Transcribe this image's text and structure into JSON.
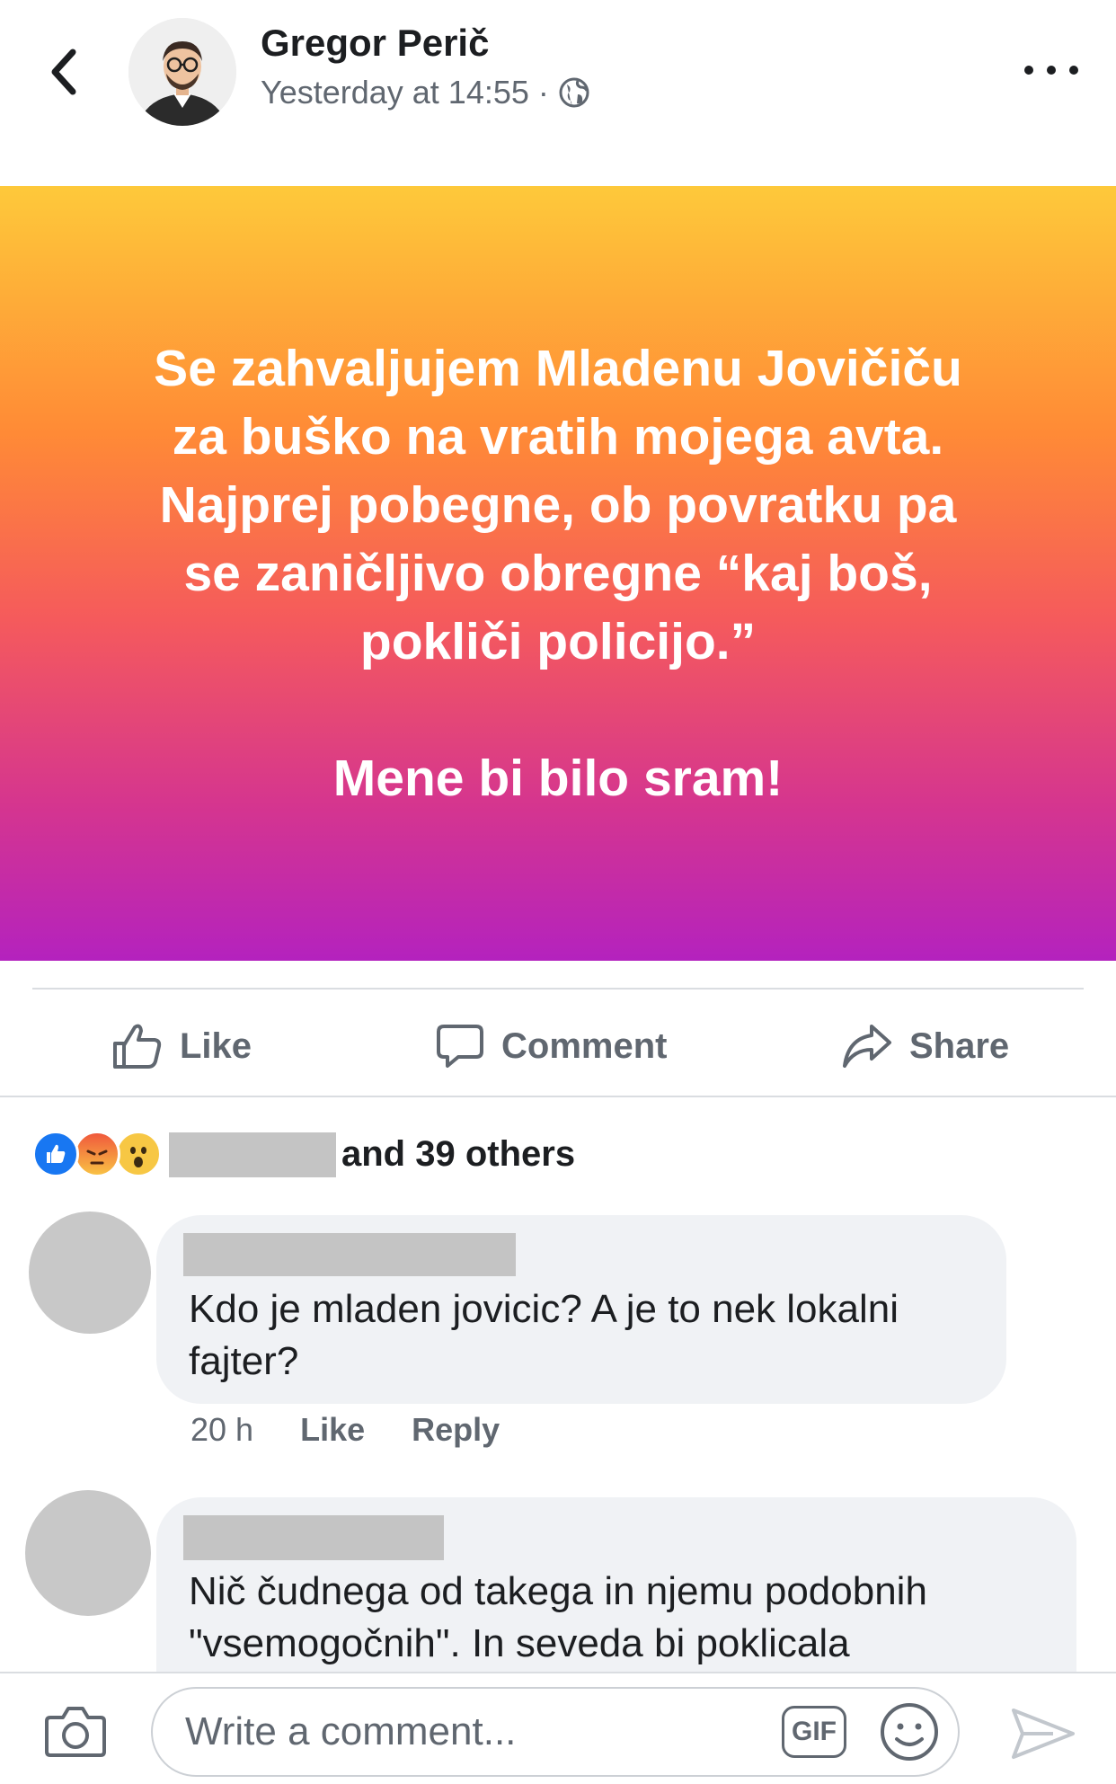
{
  "header": {
    "author": "Gregor Perič",
    "timestamp": "Yesterday at 14:55",
    "separator": "·",
    "privacy_icon": "globe-icon"
  },
  "post": {
    "text_main": "Se zahvaljujem Mladenu Jovičiču\nza buško na vratih mojega avta.\nNajprej pobegne, ob povratku pa\nse zaničljivo obregne “kaj boš,\npokliči policijo.”",
    "text_closing": "Mene bi bilo sram!",
    "gradient_colors": [
      "#fec93a",
      "#ff8a36",
      "#f55a5c",
      "#d5358f",
      "#b422be"
    ]
  },
  "actions": {
    "like": "Like",
    "comment": "Comment",
    "share": "Share"
  },
  "reactions": {
    "types": [
      "like",
      "angry",
      "wow"
    ],
    "summary": "and 39 others"
  },
  "comments": [
    {
      "text": "Kdo je mladen jovicic? A je to nek lokalni fajter?",
      "time": "20 h",
      "like_label": "Like",
      "reply_label": "Reply"
    },
    {
      "text": "Nič čudnega od takega in njemu podobnih \"vsemogočnih\". In seveda bi poklicala"
    }
  ],
  "composer": {
    "placeholder": "Write a comment...",
    "gif_label": "GIF"
  },
  "colors": {
    "text_primary": "#1c1e21",
    "text_secondary": "#606770",
    "like_blue": "#1877f2",
    "bubble_bg": "#f0f2f5"
  }
}
